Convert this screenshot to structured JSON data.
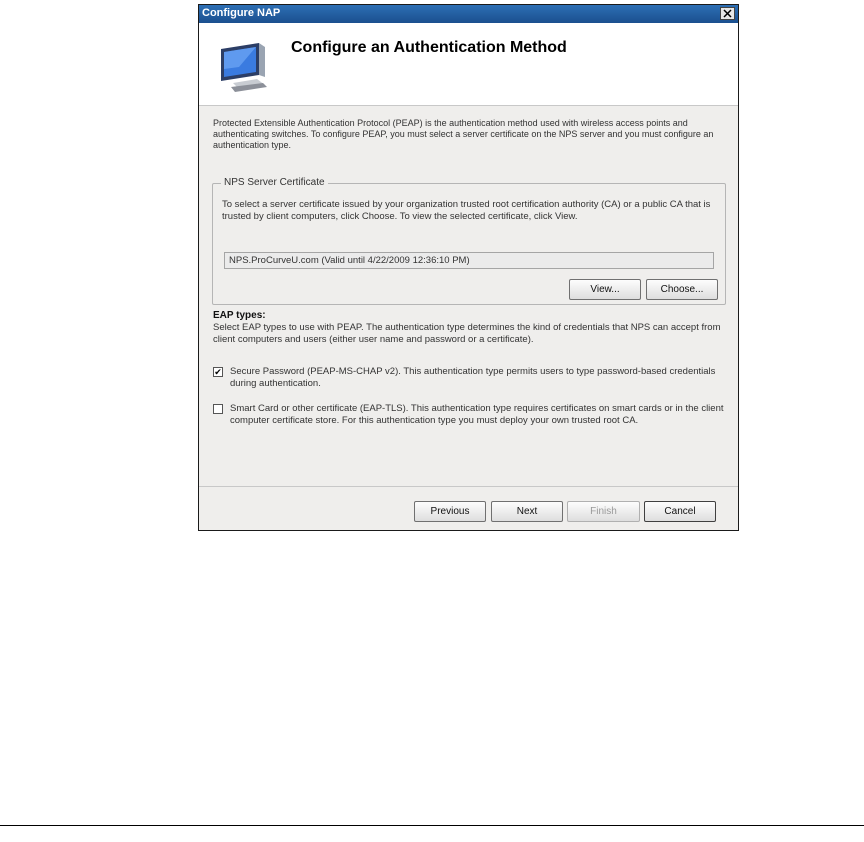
{
  "window": {
    "title": "Configure NAP"
  },
  "header": {
    "heading": "Configure an Authentication Method",
    "icon": "monitor-icon"
  },
  "intro": "Protected Extensible Authentication Protocol (PEAP) is the authentication method used with wireless access points and authenticating switches. To configure PEAP, you must select a server certificate on the NPS server and you must configure an authentication type.",
  "cert_group": {
    "label": "NPS Server Certificate",
    "description": "To select a server certificate issued by your organization trusted root certification authority (CA) or a public CA that is trusted by client computers, click Choose. To view the selected certificate, click View.",
    "certificate": "NPS.ProCurveU.com (Valid until 4/22/2009 12:36:10 PM)",
    "view_label": "View...",
    "choose_label": "Choose..."
  },
  "eap": {
    "title": "EAP types:",
    "description": "Select EAP types to use with PEAP. The authentication type determines the kind of credentials that NPS can accept from client computers and users (either user name and password or a certificate).",
    "options": [
      {
        "label": "Secure Password (PEAP-MS-CHAP v2). This authentication type permits users to type password-based credentials during authentication.",
        "checked": true,
        "mark": "✔"
      },
      {
        "label": "Smart Card or other certificate (EAP-TLS). This authentication type requires certificates on smart cards or in the client computer certificate store. For this authentication type you must deploy your own trusted root CA.",
        "checked": false,
        "mark": ""
      }
    ]
  },
  "buttons": {
    "previous": "Previous",
    "next": "Next",
    "finish": "Finish",
    "cancel": "Cancel"
  }
}
